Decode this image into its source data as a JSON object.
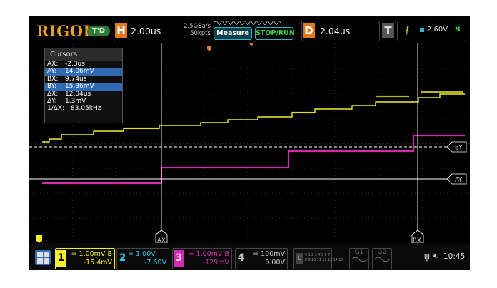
{
  "brand": "RIGOL",
  "trigger_status": "T'D",
  "horizontal": {
    "label": "H",
    "timebase": "2.00us",
    "sample_rate": "2.5GSa/s",
    "memory_depth": "50kpts"
  },
  "buttons": {
    "measure": "Measure",
    "stop_run": "STOP/RUN"
  },
  "delay": {
    "label": "D",
    "value": "2.04us"
  },
  "trigger": {
    "label": "T",
    "level": "2.60V",
    "mode": "N",
    "icon": "rising-edge-icon"
  },
  "cursors": {
    "title": "Cursors",
    "rows": [
      {
        "key": "AX:",
        "value": "-2.3us",
        "highlight": false
      },
      {
        "key": "AY:",
        "value": "14.06mV",
        "highlight": true
      },
      {
        "key": "BX:",
        "value": "9.74us",
        "highlight": false
      },
      {
        "key": "BY:",
        "value": "15.36mV",
        "highlight": true
      },
      {
        "key": "ΔX:",
        "value": "12.04us",
        "highlight": false
      },
      {
        "key": "ΔY:",
        "value": "1.3mV",
        "highlight": false
      },
      {
        "key": "1/ΔX:",
        "value": "83.05kHz",
        "highlight": false
      }
    ],
    "markers": {
      "ax": "AX",
      "bx": "BX",
      "ay": "AY",
      "by": "BY"
    }
  },
  "channels": [
    {
      "num": "1",
      "scale": "= 1.00mV",
      "flag": "B",
      "offset": "-15.4mV",
      "color": "#f2ee2a",
      "active": true
    },
    {
      "num": "2",
      "scale": "= 1.00V",
      "flag": "",
      "offset": "-7.60V",
      "color": "#2fc7e6",
      "active": false
    },
    {
      "num": "3",
      "scale": "= 1.00mV",
      "flag": "B",
      "offset": "-129mV",
      "color": "#d22bb0",
      "active": false
    },
    {
      "num": "4",
      "scale": "= 100mV",
      "flag": "",
      "offset": "0.00V",
      "color": "#bbbbbb",
      "active": false
    }
  ],
  "digital": {
    "label": "L",
    "row1": "0 1 2 3  4 5 6 7",
    "row2": "8 9 10 11  12 13 14 15"
  },
  "generators": [
    {
      "label": "G1"
    },
    {
      "label": "G2"
    }
  ],
  "status": {
    "time": "10:45",
    "usb_icon": "usb-icon",
    "speaker_icon": "speaker-muted-icon"
  },
  "colors": {
    "ch1": "#f2ee2a",
    "ch3": "#d22bb0",
    "accent": "#e07a1e",
    "cursor": "#ffffff"
  }
}
